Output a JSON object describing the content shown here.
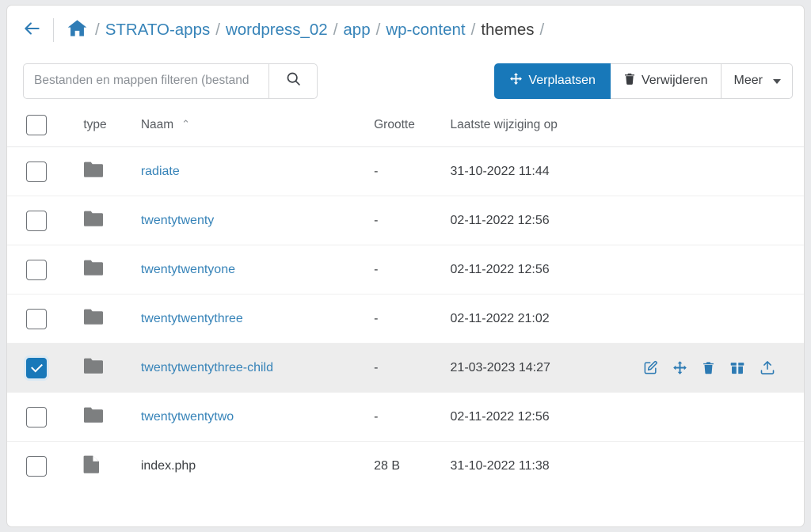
{
  "breadcrumb": {
    "back_icon": "arrow-left-icon",
    "home_icon": "home-icon",
    "segments": [
      {
        "label": "STRATO-apps",
        "link": true
      },
      {
        "label": "wordpress_02",
        "link": true
      },
      {
        "label": "app",
        "link": true
      },
      {
        "label": "wp-content",
        "link": true
      },
      {
        "label": "themes",
        "link": false
      }
    ],
    "separator": "/"
  },
  "toolbar": {
    "filter_placeholder": "Bestanden en mappen filteren (bestand",
    "filter_value": "",
    "search_icon": "search-icon",
    "move_label": "Verplaatsen",
    "move_icon": "move-arrows-icon",
    "delete_label": "Verwijderen",
    "delete_icon": "trash-icon",
    "more_label": "Meer",
    "more_icon": "chevron-down-icon"
  },
  "table": {
    "headers": {
      "type": "type",
      "name": "Naam",
      "size": "Grootte",
      "modified": "Laatste wijziging op"
    },
    "sort": {
      "column": "Naam",
      "direction": "asc",
      "glyph": "⌃"
    },
    "rows": [
      {
        "name": "radiate",
        "kind": "folder",
        "size": "-",
        "modified": "31-10-2022 11:44",
        "selected": false
      },
      {
        "name": "twentytwenty",
        "kind": "folder",
        "size": "-",
        "modified": "02-11-2022 12:56",
        "selected": false
      },
      {
        "name": "twentytwentyone",
        "kind": "folder",
        "size": "-",
        "modified": "02-11-2022 12:56",
        "selected": false
      },
      {
        "name": "twentytwentythree",
        "kind": "folder",
        "size": "-",
        "modified": "02-11-2022 21:02",
        "selected": false
      },
      {
        "name": "twentytwentythree-child",
        "kind": "folder",
        "size": "-",
        "modified": "21-03-2023 14:27",
        "selected": true
      },
      {
        "name": "twentytwentytwo",
        "kind": "folder",
        "size": "-",
        "modified": "02-11-2022 12:56",
        "selected": false
      },
      {
        "name": "index.php",
        "kind": "file",
        "size": "28 B",
        "modified": "31-10-2022 11:38",
        "selected": false
      }
    ],
    "row_actions": [
      {
        "name": "edit-icon"
      },
      {
        "name": "move-arrows-icon"
      },
      {
        "name": "trash-icon"
      },
      {
        "name": "archive-icon"
      },
      {
        "name": "upload-icon"
      }
    ]
  },
  "colors": {
    "primary": "#1878b9",
    "link": "#3683b8",
    "folder": "#7d7f80",
    "selected_row": "#ededed"
  }
}
